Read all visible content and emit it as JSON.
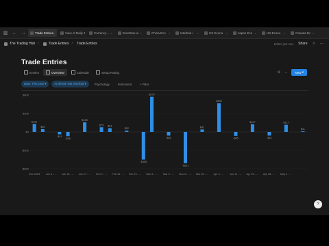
{
  "tabs": [
    {
      "label": "Trade Entries",
      "active": true
    },
    {
      "label": "View of Daily J",
      "active": false
    },
    {
      "label": "Currency ...",
      "active": false
    },
    {
      "label": "EuroStox w",
      "active": false
    },
    {
      "label": "China Eco",
      "active": false
    },
    {
      "label": "Interbnk i",
      "active": false
    },
    {
      "label": "US Econo",
      "active": false
    },
    {
      "label": "Japan Eco",
      "active": false
    },
    {
      "label": "US Econo",
      "active": false
    },
    {
      "label": "Canada Ec",
      "active": false
    }
  ],
  "breadcrumb": {
    "workspace": "The Trading Hub",
    "parent": "Trade Entries",
    "current": "Trade Entries"
  },
  "topbar": {
    "edited": "Edited just now",
    "share": "Share"
  },
  "page": {
    "title": "Trade Entries"
  },
  "views": [
    "Entries",
    "Overview",
    "Calendar",
    "Setup Rating"
  ],
  "active_view": "Overview",
  "view_actions": {
    "new_label": "New"
  },
  "filters": [
    {
      "label": "Date: This year",
      "style": "blue"
    },
    {
      "label": "Archived: Not checked",
      "style": "blue"
    },
    {
      "label": "Psychology",
      "style": "plain"
    },
    {
      "label": "Instrument",
      "style": "plain"
    },
    {
      "label": "+ Filter",
      "style": "plain"
    }
  ],
  "chart_data": {
    "type": "bar",
    "color": "#2f8fe6",
    "y_ticks": [
      "$600",
      "$300",
      "$0",
      "-$300",
      "-$600"
    ],
    "ylim": [
      -600,
      600
    ],
    "categories": [
      "Dec 2023",
      "",
      "Jan 6 - ...",
      "",
      "Jan 16 - ...",
      "",
      "Jan 27 - ...",
      "",
      "Feb 2 - ...",
      "",
      "Feb 13 - ...",
      "",
      "Feb 23 - ...",
      "",
      "Mar 3 - ...",
      "",
      "Mar 9 - ...",
      "",
      "Mar 17 - ...",
      "",
      "Mar 26 - ...",
      "",
      "Apr 4 - ...",
      "",
      "Apr 11 - ...",
      "",
      "Apr 20 - ...",
      "",
      "Apr 28 - ...",
      "",
      "May 3 - ..."
    ],
    "values": [
      130,
      45,
      0,
      -40,
      -70,
      0,
      155,
      0,
      75,
      60,
      0,
      20,
      0,
      -450,
      570,
      0,
      -60,
      0,
      -510,
      0,
      40,
      0,
      465,
      0,
      -65,
      0,
      125,
      0,
      -60,
      0,
      115,
      0,
      10
    ],
    "value_labels": [
      "$131",
      "$45",
      "",
      "-$41",
      "-$66",
      "",
      "$155",
      "",
      "$75",
      "$61",
      "",
      "$22",
      "",
      "-$455",
      "$570",
      "",
      "-$61",
      "",
      "-$511",
      "",
      "$41",
      "",
      "$465",
      "",
      "-$65",
      "",
      "$127",
      "",
      "-$61",
      "",
      "$117",
      "",
      "$11"
    ]
  }
}
